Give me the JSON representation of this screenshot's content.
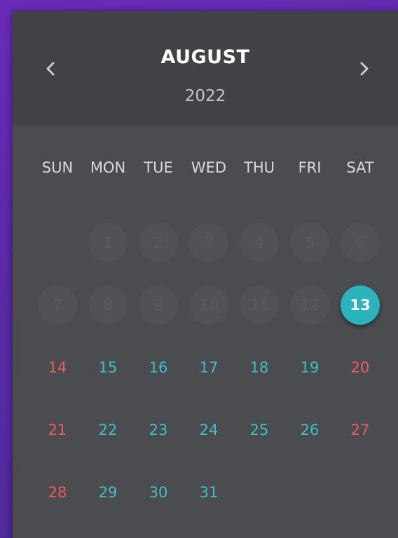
{
  "header": {
    "month": "AUGUST",
    "year": "2022",
    "prev_icon": "chevron-left-icon",
    "next_icon": "chevron-right-icon"
  },
  "weekdays": [
    "SUN",
    "MON",
    "TUE",
    "WED",
    "THU",
    "FRI",
    "SAT"
  ],
  "days": [
    {
      "label": "",
      "state": "empty"
    },
    {
      "label": "1",
      "state": "past"
    },
    {
      "label": "2",
      "state": "past"
    },
    {
      "label": "3",
      "state": "past"
    },
    {
      "label": "4",
      "state": "past"
    },
    {
      "label": "5",
      "state": "past"
    },
    {
      "label": "6",
      "state": "past"
    },
    {
      "label": "7",
      "state": "past"
    },
    {
      "label": "8",
      "state": "past"
    },
    {
      "label": "9",
      "state": "past"
    },
    {
      "label": "10",
      "state": "past"
    },
    {
      "label": "11",
      "state": "past"
    },
    {
      "label": "12",
      "state": "past"
    },
    {
      "label": "13",
      "state": "today"
    },
    {
      "label": "14",
      "state": "weekend"
    },
    {
      "label": "15",
      "state": "future"
    },
    {
      "label": "16",
      "state": "future"
    },
    {
      "label": "17",
      "state": "future"
    },
    {
      "label": "18",
      "state": "future"
    },
    {
      "label": "19",
      "state": "future"
    },
    {
      "label": "20",
      "state": "weekend"
    },
    {
      "label": "21",
      "state": "weekend"
    },
    {
      "label": "22",
      "state": "future"
    },
    {
      "label": "23",
      "state": "future"
    },
    {
      "label": "24",
      "state": "future"
    },
    {
      "label": "25",
      "state": "future"
    },
    {
      "label": "26",
      "state": "future"
    },
    {
      "label": "27",
      "state": "weekend"
    },
    {
      "label": "28",
      "state": "weekend"
    },
    {
      "label": "29",
      "state": "future"
    },
    {
      "label": "30",
      "state": "future"
    },
    {
      "label": "31",
      "state": "future"
    }
  ],
  "colors": {
    "background": "#5a2aa8",
    "panel": "#4a4c4f",
    "header": "#404245",
    "accent": "#2ab3bd",
    "weekday_text": "#3fc0c6",
    "weekend_text": "#ee5b5f",
    "past_circle": "#505255"
  }
}
